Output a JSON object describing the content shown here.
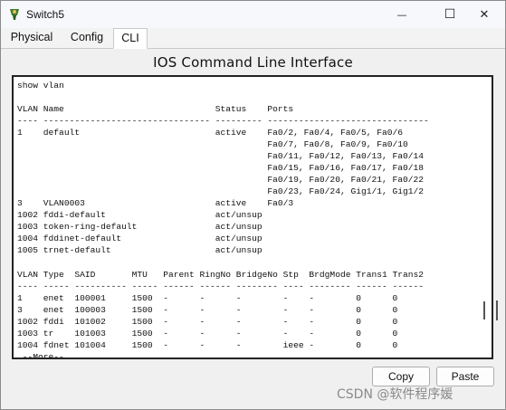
{
  "window": {
    "title": "Switch5",
    "minimize_glyph": "—",
    "maximize_glyph": "☐",
    "close_glyph": "✕"
  },
  "tabs": [
    {
      "label": "Physical",
      "active": false
    },
    {
      "label": "Config",
      "active": false
    },
    {
      "label": "CLI",
      "active": true
    }
  ],
  "cli": {
    "header": "IOS Command Line Interface",
    "output_lines": [
      "show vlan",
      "",
      "VLAN Name                             Status    Ports",
      "---- -------------------------------- --------- -------------------------------",
      "1    default                          active    Fa0/2, Fa0/4, Fa0/5, Fa0/6",
      "                                                Fa0/7, Fa0/8, Fa0/9, Fa0/10",
      "                                                Fa0/11, Fa0/12, Fa0/13, Fa0/14",
      "                                                Fa0/15, Fa0/16, Fa0/17, Fa0/18",
      "                                                Fa0/19, Fa0/20, Fa0/21, Fa0/22",
      "                                                Fa0/23, Fa0/24, Gig1/1, Gig1/2",
      "3    VLAN0003                         active    Fa0/3",
      "1002 fddi-default                     act/unsup",
      "1003 token-ring-default               act/unsup",
      "1004 fddinet-default                  act/unsup",
      "1005 trnet-default                    act/unsup",
      "",
      "VLAN Type  SAID       MTU   Parent RingNo BridgeNo Stp  BrdgMode Trans1 Trans2",
      "---- ----- ---------- ----- ------ ------ -------- ---- -------- ------ ------",
      "1    enet  100001     1500  -      -      -        -    -        0      0",
      "3    enet  100003     1500  -      -      -        -    -        0      0",
      "1002 fddi  101002     1500  -      -      -        -    -        0      0",
      "1003 tr    101003     1500  -      -      -        -    -        0      0",
      "1004 fdnet 101004     1500  -      -      -        ieee -        0      0",
      " --More--"
    ]
  },
  "buttons": {
    "copy_label": "Copy",
    "paste_label": "Paste"
  },
  "watermark": "CSDN @软件程序媛",
  "icons": {
    "app": "switch-app-icon",
    "minimize": "minimize-icon",
    "maximize": "maximize-icon",
    "close": "close-icon"
  }
}
